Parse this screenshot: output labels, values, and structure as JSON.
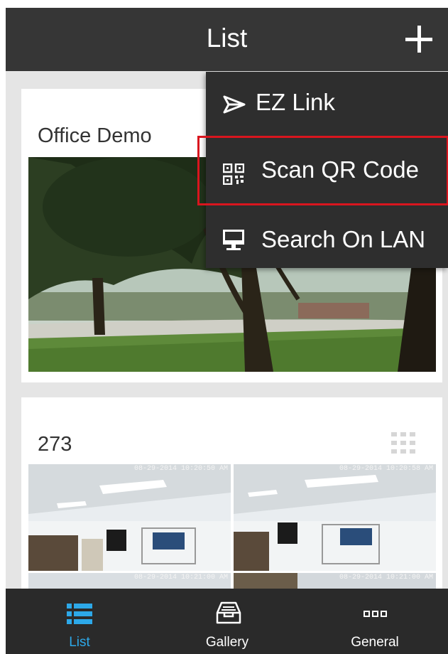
{
  "header": {
    "title": "List",
    "add_icon": "plus-icon"
  },
  "dropdown_menu": {
    "items": [
      {
        "label": "EZ Link",
        "icon": "send-arrow-icon"
      },
      {
        "label": "Scan QR Code",
        "icon": "qr-code-icon",
        "highlighted": true
      },
      {
        "label": "Search On LAN",
        "icon": "monitor-icon"
      }
    ],
    "highlight_color": "#d9151e"
  },
  "devices": [
    {
      "name": "Office Demo"
    },
    {
      "name": "273",
      "layout_icon": "grid-icon",
      "timestamps": [
        "08-29-2014 10:20:50 AM",
        "08-29-2014 10:20:58 AM",
        "08-29-2014 10:21:00 AM",
        "08-29-2014 10:21:00 AM"
      ]
    }
  ],
  "tabs": [
    {
      "label": "List",
      "icon": "list-icon",
      "active": true
    },
    {
      "label": "Gallery",
      "icon": "gallery-tray-icon"
    },
    {
      "label": "General",
      "icon": "more-dots-icon"
    }
  ],
  "colors": {
    "accent": "#2da8e8",
    "bar_bg": "#363636",
    "tab_bg": "#2a2a2a"
  }
}
